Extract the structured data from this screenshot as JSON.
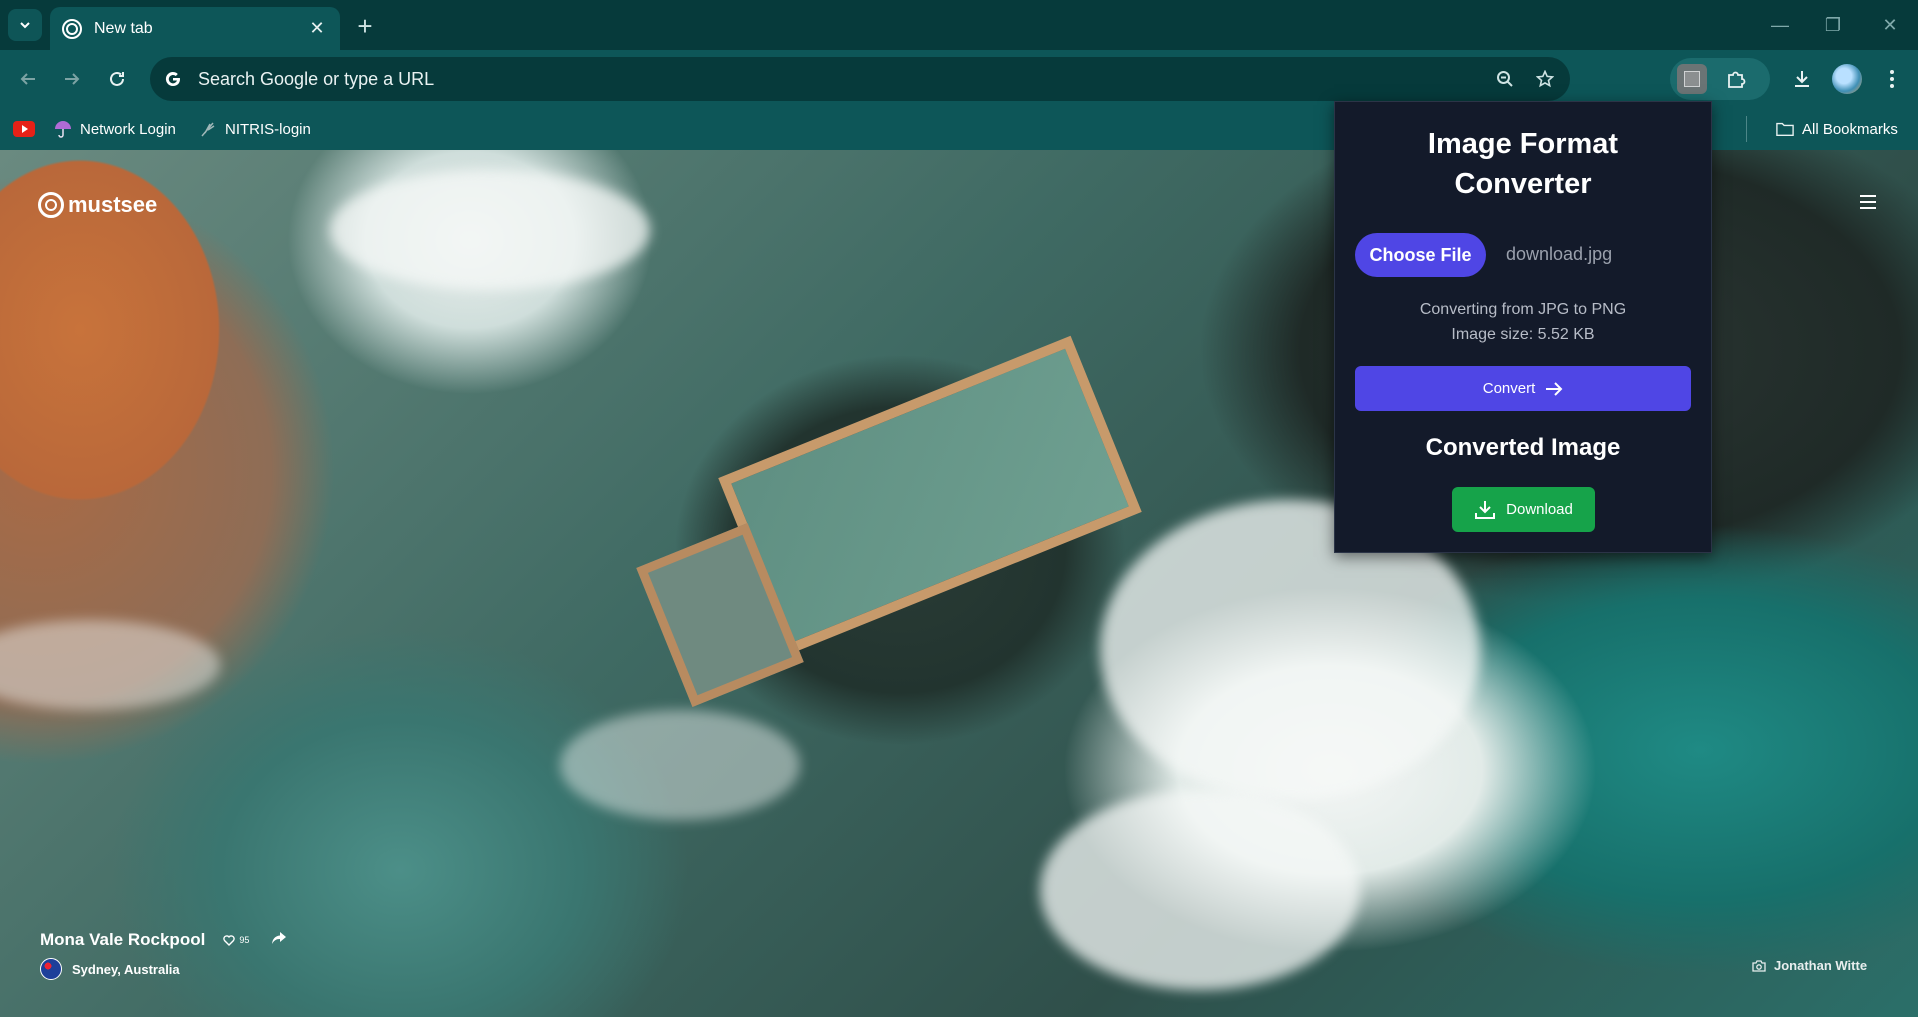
{
  "browser": {
    "tab": {
      "title": "New tab"
    },
    "omnibox": {
      "placeholder": "Search Google or type a URL"
    },
    "bookmarks": {
      "items": [
        {
          "label": "",
          "icon": "youtube-icon"
        },
        {
          "label": "Network Login",
          "icon": "umbrella-icon"
        },
        {
          "label": "NITRIS-login",
          "icon": "feather-icon"
        }
      ],
      "all_bookmarks": "All Bookmarks"
    }
  },
  "newtab": {
    "brand": "mustsee",
    "photo": {
      "title": "Mona Vale Rockpool",
      "likes": "95",
      "location": "Sydney, Australia",
      "credit": "Jonathan Witte"
    }
  },
  "extension": {
    "title": "Image Format Converter",
    "choose_file_label": "Choose File",
    "file_name": "download.jpg",
    "converting_text": "Converting from JPG to PNG",
    "image_size_text": "Image size: 5.52 KB",
    "convert_label": "Convert",
    "converted_heading": "Converted Image",
    "download_label": "Download"
  },
  "colors": {
    "frame": "#063a3b",
    "toolbar": "#0d5658",
    "popup_bg": "#131a2a",
    "primary_button": "#4f46e5",
    "download_button": "#16a34a"
  }
}
